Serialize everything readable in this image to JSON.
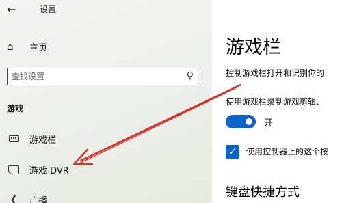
{
  "window": {
    "title": "设置"
  },
  "sidebar": {
    "home_label": "主页",
    "search": {
      "placeholder": "查找设置"
    },
    "section_label": "游戏",
    "items": [
      {
        "label": "游戏栏",
        "icon": "gamebar-icon"
      },
      {
        "label": "游戏 DVR",
        "icon": "dvr-icon"
      },
      {
        "label": "广播",
        "icon": "broadcast-icon"
      }
    ]
  },
  "main": {
    "title": "游戏栏",
    "description": "控制游戏栏打开和识别你的",
    "record_label": "使用游戏栏录制游戏剪辑、",
    "toggle": {
      "state_label": "开",
      "on": true
    },
    "checkbox": {
      "label": "使用控制器上的这个按",
      "checked": true
    },
    "subheading": "键盘快捷方式"
  },
  "colors": {
    "accent": "#0a64cc",
    "annotation_arrow": "#d9302a"
  }
}
